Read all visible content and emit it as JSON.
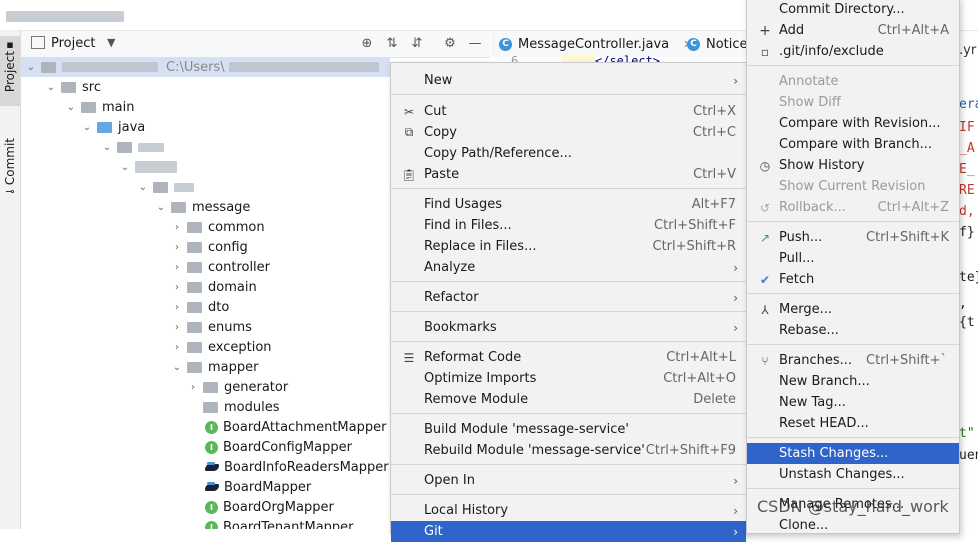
{
  "project_panel": {
    "title": "Project",
    "root_path": "C:\\Users\\"
  },
  "toolwindow_tabs": [
    "Project",
    "Commit"
  ],
  "editor": {
    "tabs": [
      {
        "label": "MessageController.java"
      },
      {
        "label": "Notice"
      }
    ],
    "line_number": "6",
    "code_line": "</select>"
  },
  "right_fragments": [
    ".yr",
    "era",
    "IF",
    "_A",
    "E_",
    "RE",
    "d,",
    "f}",
    "te}",
    ",",
    "{t",
    "t\"",
    "uen"
  ],
  "tree": {
    "src": "src",
    "main": "main",
    "java": "java",
    "message": "message",
    "folders": [
      "common",
      "config",
      "controller",
      "domain",
      "dto",
      "enums",
      "exception",
      "mapper"
    ],
    "mapper_children": [
      "generator",
      "modules"
    ],
    "files": [
      "BoardAttachmentMapper",
      "BoardConfigMapper",
      "BoardInfoReadersMapper",
      "BoardMapper",
      "BoardOrgMapper",
      "BoardTenantMapper"
    ]
  },
  "context_menu": {
    "items": [
      {
        "label": "New",
        "submenu": "›"
      },
      {
        "label": "Cut",
        "shortcut": "Ctrl+X",
        "icon": "cut-icon"
      },
      {
        "label": "Copy",
        "shortcut": "Ctrl+C",
        "icon": "copy-icon"
      },
      {
        "label": "Copy Path/Reference..."
      },
      {
        "label": "Paste",
        "shortcut": "Ctrl+V",
        "icon": "paste-icon"
      },
      {
        "label": "Find Usages",
        "shortcut": "Alt+F7"
      },
      {
        "label": "Find in Files...",
        "shortcut": "Ctrl+Shift+F"
      },
      {
        "label": "Replace in Files...",
        "shortcut": "Ctrl+Shift+R"
      },
      {
        "label": "Analyze",
        "submenu": "›"
      },
      {
        "label": "Refactor",
        "submenu": "›"
      },
      {
        "label": "Bookmarks",
        "submenu": "›"
      },
      {
        "label": "Reformat Code",
        "shortcut": "Ctrl+Alt+L",
        "icon": "reformat-icon"
      },
      {
        "label": "Optimize Imports",
        "shortcut": "Ctrl+Alt+O"
      },
      {
        "label": "Remove Module",
        "shortcut": "Delete"
      },
      {
        "label": "Build Module 'message-service'"
      },
      {
        "label": "Rebuild Module 'message-service'",
        "shortcut": "Ctrl+Shift+F9"
      },
      {
        "label": "Open In",
        "submenu": "›"
      },
      {
        "label": "Local History",
        "submenu": "›"
      },
      {
        "label": "Git",
        "submenu": "›"
      }
    ]
  },
  "git_menu": {
    "items": [
      {
        "label": "Commit Directory..."
      },
      {
        "label": "Add",
        "shortcut": "Ctrl+Alt+A",
        "icon": "plus-icon"
      },
      {
        "label": ".git/info/exclude",
        "icon": "file-icon"
      },
      {
        "label": "Annotate"
      },
      {
        "label": "Show Diff"
      },
      {
        "label": "Compare with Revision..."
      },
      {
        "label": "Compare with Branch..."
      },
      {
        "label": "Show History",
        "icon": "clock-icon"
      },
      {
        "label": "Show Current Revision"
      },
      {
        "label": "Rollback...",
        "shortcut": "Ctrl+Alt+Z",
        "icon": "rollback-icon"
      },
      {
        "label": "Push...",
        "shortcut": "Ctrl+Shift+K",
        "icon": "push-arrow-icon"
      },
      {
        "label": "Pull..."
      },
      {
        "label": "Fetch",
        "icon": "fetch-check-icon"
      },
      {
        "label": "Merge...",
        "icon": "merge-icon"
      },
      {
        "label": "Rebase..."
      },
      {
        "label": "Branches...",
        "shortcut": "Ctrl+Shift+`",
        "icon": "branch-icon"
      },
      {
        "label": "New Branch..."
      },
      {
        "label": "New Tag..."
      },
      {
        "label": "Reset HEAD..."
      },
      {
        "label": "Stash Changes..."
      },
      {
        "label": "Unstash Changes..."
      },
      {
        "label": "Manage Remotes..."
      },
      {
        "label": "Clone..."
      }
    ]
  },
  "watermark": "CSDN @stay_hard_work",
  "colors": {
    "selection": "#2f65ca",
    "menu_bg": "#f2f2f2",
    "interface_icon": "#5ab75a",
    "class_icon": "#3d95d8"
  }
}
